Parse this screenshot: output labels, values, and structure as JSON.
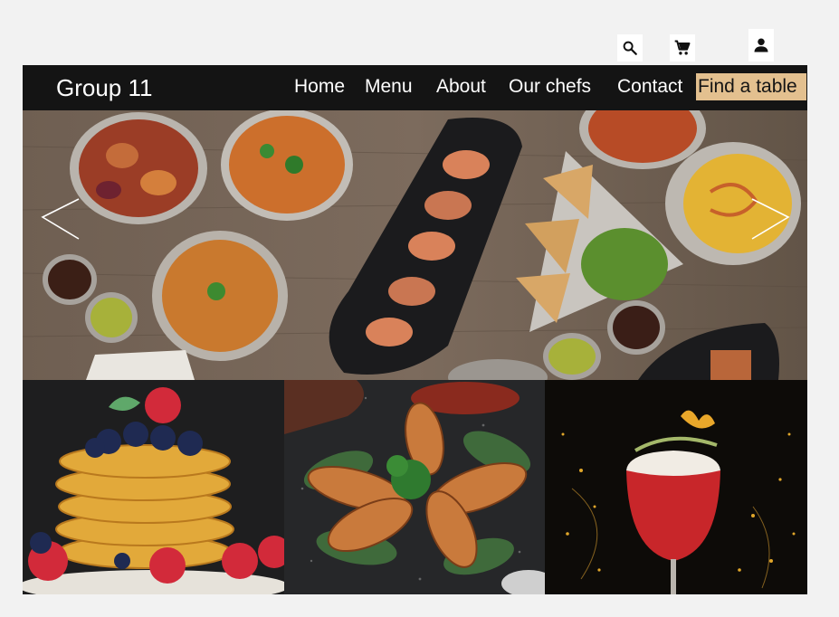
{
  "header": {
    "brand": "Group 11",
    "nav": {
      "home": "Home",
      "menu": "Menu",
      "about": "About",
      "chefs": "Our chefs",
      "contact": "Contact"
    },
    "cta": "Find a table"
  },
  "utility_icons": [
    "search-icon",
    "cart-icon",
    "user-icon"
  ],
  "carousel": {
    "prev_icon": "chevron-left-icon",
    "next_icon": "chevron-right-icon"
  },
  "colors": {
    "navbar_bg": "#141414",
    "cta_bg": "#e3c08f",
    "page_bg": "#f2f2f2"
  }
}
